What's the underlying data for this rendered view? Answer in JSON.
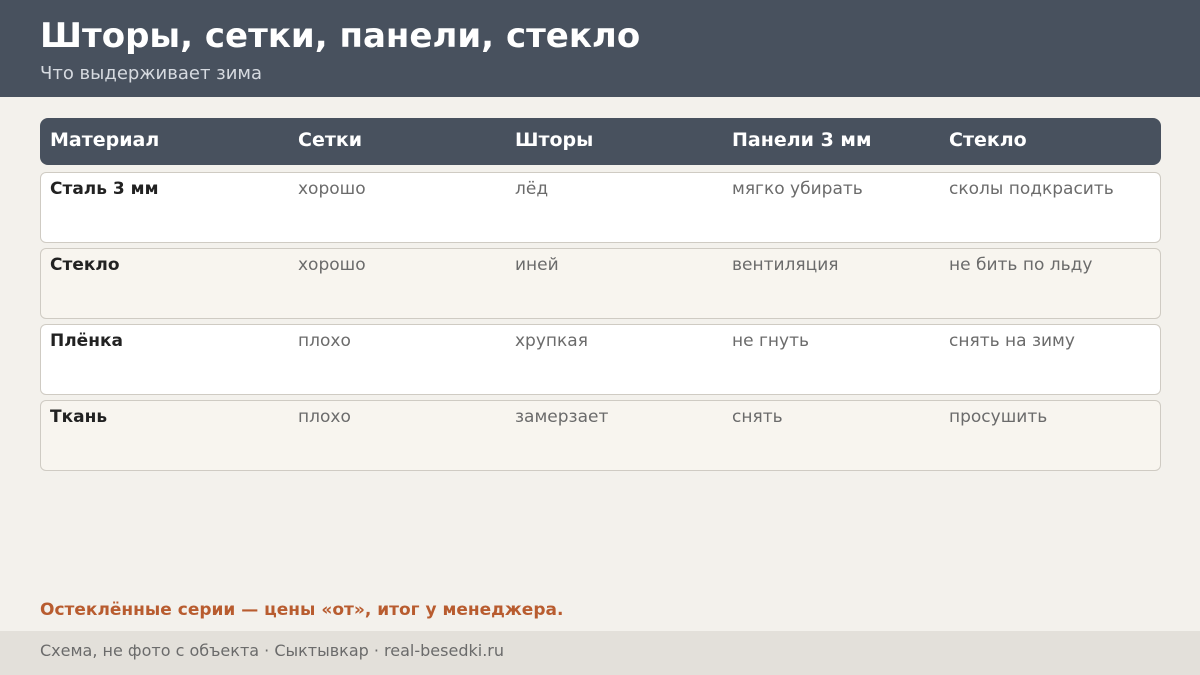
{
  "header": {
    "title": "Шторы, сетки, панели, стекло",
    "subtitle": "Что выдерживает зима"
  },
  "table": {
    "columns": [
      "Материал",
      "Сетки",
      "Шторы",
      "Панели 3 мм",
      "Стекло"
    ],
    "rows": [
      [
        "Сталь 3 мм",
        "хорошо",
        "лёд",
        "мягко убирать",
        "сколы подкрасить"
      ],
      [
        "Стекло",
        "хорошо",
        "иней",
        "вентиляция",
        "не бить по льду"
      ],
      [
        "Плёнка",
        "плохо",
        "хрупкая",
        "не гнуть",
        "снять на зиму"
      ],
      [
        "Ткань",
        "плохо",
        "замерзает",
        "снять",
        "просушить"
      ]
    ]
  },
  "note": "Остеклённые серии — цены «от», итог у менеджера.",
  "footer": {
    "text": "Схема, не фото с объекта  ·  Сыктывкар  ·  real-besedki.ru"
  },
  "colors": {
    "header_bg": "#48515e",
    "accent": "#b85c2f",
    "page_bg": "#f3f1ec"
  }
}
